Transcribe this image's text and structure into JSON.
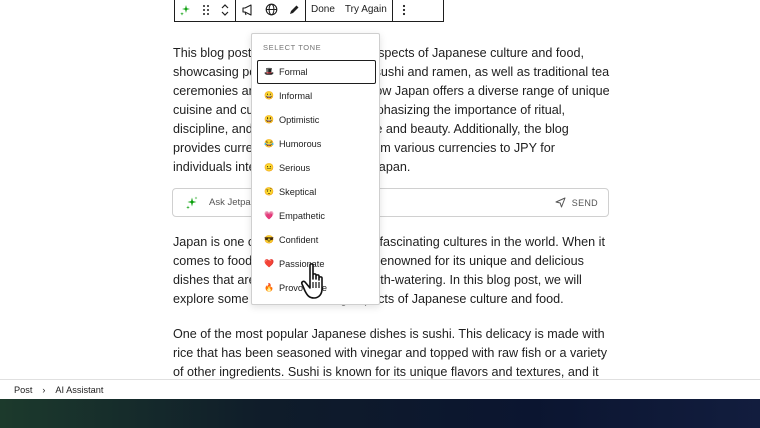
{
  "toolbar": {
    "done_label": "Done",
    "try_again_label": "Try Again"
  },
  "content": {
    "paragraph_1": "This blog post explores the various aspects of Japanese culture and food, showcasing popular dishes such as sushi and ramen, as well as traditional tea ceremonies and festivals. It shows how Japan offers a diverse range of unique cuisine and cultural experiences, emphasizing the importance of ritual, discipline, and appreciation for nature and beauty. Additionally, the blog provides currency exchange rates from various currencies to JPY for individuals interested in traveling to Japan.",
    "paragraph_2": "Japan is one of the most unique and fascinating cultures in the world. When it comes to food, the country is widely renowned for its unique and delicious dishes that are both healthy and mouth-watering. In this blog post, we will explore some of the fascinating aspects of Japanese culture and food.",
    "paragraph_3": "One of the most popular Japanese dishes is sushi. This delicacy is made with rice that has been seasoned with vinegar and topped with raw fish or a variety of other ingredients. Sushi is known for its unique flavors and textures, and it represents an"
  },
  "ai_bar": {
    "placeholder": "Ask Jetpack AI",
    "send_label": "SEND"
  },
  "tone_menu": {
    "title": "SELECT TONE",
    "selected": "Formal",
    "items": [
      {
        "emoji": "🎩",
        "label": "Formal"
      },
      {
        "emoji": "😀",
        "label": "Informal"
      },
      {
        "emoji": "😃",
        "label": "Optimistic"
      },
      {
        "emoji": "😂",
        "label": "Humorous"
      },
      {
        "emoji": "😐",
        "label": "Serious"
      },
      {
        "emoji": "🤨",
        "label": "Skeptical"
      },
      {
        "emoji": "💗",
        "label": "Empathetic"
      },
      {
        "emoji": "😎",
        "label": "Confident"
      },
      {
        "emoji": "❤️",
        "label": "Passionate"
      },
      {
        "emoji": "🔥",
        "label": "Provocative"
      }
    ]
  },
  "breadcrumb": {
    "root": "Post",
    "current": "AI Assistant"
  },
  "colors": {
    "accent_green": "#069e08",
    "text": "#1e1e1e",
    "muted": "#757575"
  }
}
